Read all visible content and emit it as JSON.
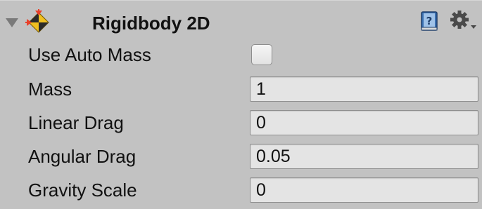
{
  "component": {
    "title": "Rigidbody 2D",
    "icons": [
      "foldout-arrow",
      "rigidbody2d-icon",
      "help-book-icon",
      "gear-icon"
    ],
    "colors": {
      "panel_bg": "#c2c2c2",
      "field_bg": "#e4e4e4",
      "field_border": "#8e8e8e",
      "icon_red": "#e8402a",
      "icon_yellow": "#f0c020",
      "help_blue": "#3a6fb0"
    }
  },
  "fields": {
    "use_auto_mass": {
      "label": "Use Auto Mass",
      "checked": false
    },
    "mass": {
      "label": "Mass",
      "value": "1"
    },
    "linear_drag": {
      "label": "Linear Drag",
      "value": "0"
    },
    "angular_drag": {
      "label": "Angular Drag",
      "value": "0.05"
    },
    "gravity_scale": {
      "label": "Gravity Scale",
      "value": "0"
    }
  }
}
